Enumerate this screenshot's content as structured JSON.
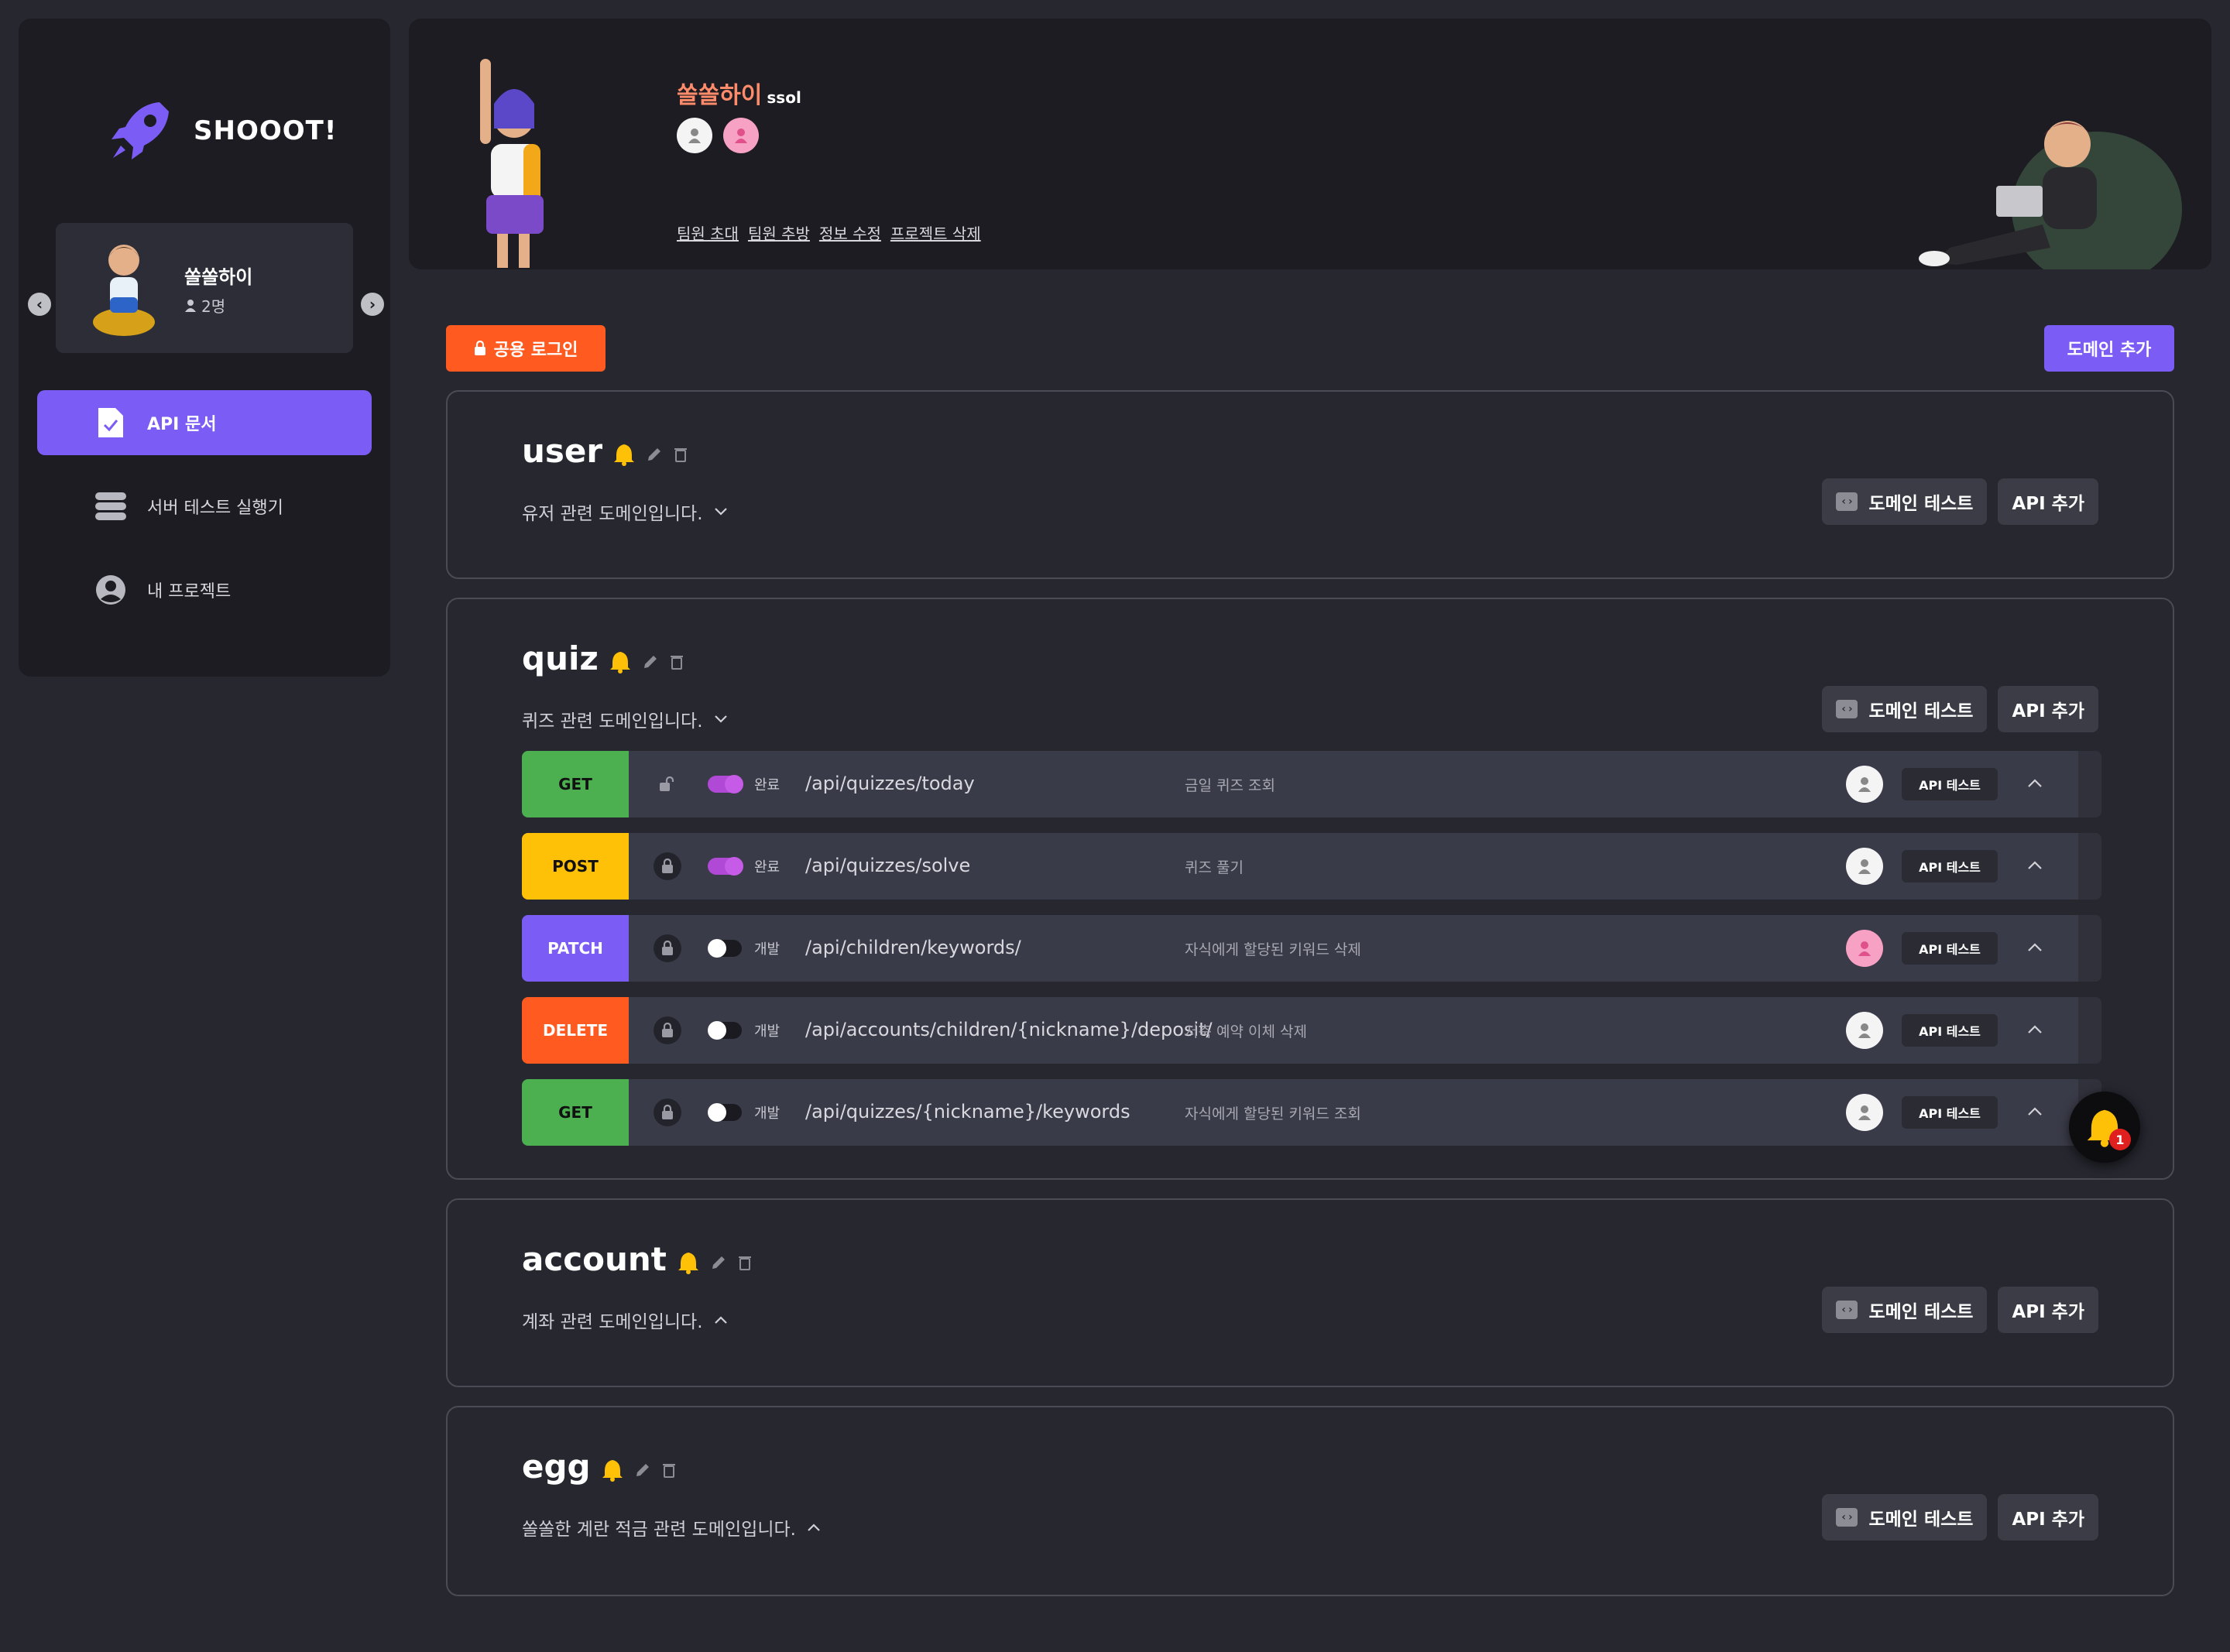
{
  "app": {
    "name": "SHOOOT!"
  },
  "project": {
    "name": "쏠쏠하이",
    "member_count": "2명"
  },
  "sidebar": {
    "items": [
      {
        "label": "API 문서",
        "icon": "document-check-icon",
        "active": true
      },
      {
        "label": "서버 테스트 실행기",
        "icon": "server-icon",
        "active": false
      },
      {
        "label": "내 프로젝트",
        "icon": "user-circle-icon",
        "active": false
      }
    ]
  },
  "header": {
    "team_name": "쏠쏠하이",
    "team_id": "ssol",
    "links": [
      "팀원 초대",
      "팀원 추방",
      "정보 수정",
      "프로젝트 삭제"
    ]
  },
  "toolbar": {
    "login_label": "공용 로그인",
    "add_domain_label": "도메인 추가"
  },
  "domain_buttons": {
    "test_label": "도메인 테스트",
    "add_api_label": "API 추가"
  },
  "api_test_label": "API 테스트",
  "domains": [
    {
      "name": "user",
      "description": "유저 관련 도메인입니다.",
      "expanded": false
    },
    {
      "name": "quiz",
      "description": "퀴즈 관련 도메인입니다.",
      "expanded": true,
      "apis": [
        {
          "method": "GET",
          "status": "완료",
          "path": "/api/quizzes/today",
          "summary": "금일 퀴즈 조회",
          "locked": false,
          "done": true,
          "assignee": "white"
        },
        {
          "method": "POST",
          "status": "완료",
          "path": "/api/quizzes/solve",
          "summary": "퀴즈 풀기",
          "locked": true,
          "done": true,
          "assignee": "white"
        },
        {
          "method": "PATCH",
          "status": "개발",
          "path": "/api/children/keywords/",
          "summary": "자식에게 할당된 키워드 삭제",
          "locked": true,
          "done": false,
          "assignee": "pink"
        },
        {
          "method": "DELETE",
          "status": "개발",
          "path": "/api/accounts/children/{nickname}/deposit/",
          "summary": "저축 예약 이체 삭제",
          "locked": true,
          "done": false,
          "assignee": "white"
        },
        {
          "method": "GET",
          "status": "개발",
          "path": "/api/quizzes/{nickname}/keywords",
          "summary": "자식에게 할당된 키워드 조회",
          "locked": true,
          "done": false,
          "assignee": "white"
        }
      ]
    },
    {
      "name": "account",
      "description": "계좌 관련 도메인입니다.",
      "expanded": false
    },
    {
      "name": "egg",
      "description": "쏠쏠한 계란 적금 관련 도메인입니다.",
      "expanded": false
    }
  ],
  "notifications": {
    "count": "1"
  },
  "colors": {
    "accent": "#7b5cf5",
    "login": "#ff5a1f",
    "GET": "#4caf50",
    "POST": "#ffc107",
    "PATCH": "#7b5cf5",
    "DELETE": "#ff5a1f",
    "bell": "#ffc107",
    "done_toggle": "#b04ad6"
  }
}
